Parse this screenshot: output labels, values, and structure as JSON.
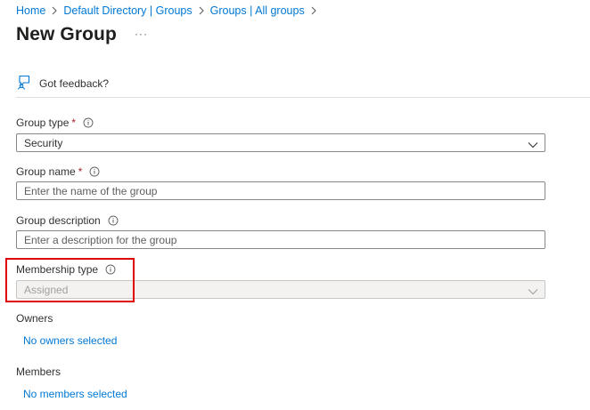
{
  "breadcrumb": [
    "Home",
    "Default Directory | Groups",
    "Groups | All groups"
  ],
  "page": {
    "title": "New Group",
    "more": "···"
  },
  "command_bar": {
    "feedback_label": "Got feedback?"
  },
  "form": {
    "group_type": {
      "label": "Group type",
      "required": "*",
      "value": "Security"
    },
    "group_name": {
      "label": "Group name",
      "required": "*",
      "placeholder": "Enter the name of the group"
    },
    "group_description": {
      "label": "Group description",
      "placeholder": "Enter a description for the group"
    },
    "membership_type": {
      "label": "Membership type",
      "value": "Assigned",
      "disabled": true
    },
    "owners": {
      "label": "Owners",
      "link": "No owners selected"
    },
    "members": {
      "label": "Members",
      "link": "No members selected"
    }
  },
  "colors": {
    "link": "#0078d4",
    "required": "#a4262c",
    "highlight": "#e00000"
  },
  "icons": [
    "chevron-right-icon",
    "feedback-icon",
    "info-icon",
    "chevron-down-icon"
  ]
}
